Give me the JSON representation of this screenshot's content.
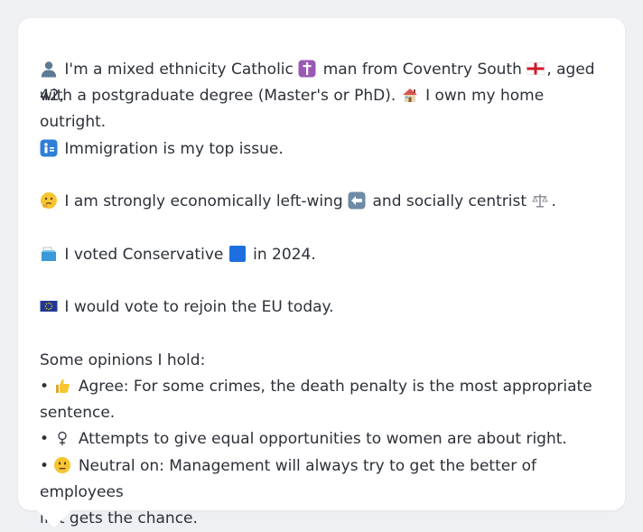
{
  "profile": {
    "intro_line1_part1": "I'm a mixed ethnicity Catholic",
    "intro_line1_part2": "man from Coventry South",
    "intro_line1_part3": ", aged 42,",
    "intro_line2_part1": "with a postgraduate degree (Master's or PhD).",
    "intro_line2_part2": "I own my home outright."
  },
  "top_issue": "Immigration is my top issue.",
  "stance": {
    "part1": "I am strongly economically left-wing",
    "part2": "and socially centrist",
    "part3": "."
  },
  "vote": {
    "part1": "I voted Conservative",
    "part2": "in 2024."
  },
  "eu": "I would vote to rejoin the EU today.",
  "opinions": {
    "heading": "Some opinions I hold:",
    "items": [
      {
        "bullet": "•",
        "line1": "Agree: For some crimes, the death penalty is the most appropriate",
        "line2": "sentence."
      },
      {
        "bullet": "•",
        "line1": "Attempts to give equal opportunities to women are about right."
      },
      {
        "bullet": "•",
        "line1": "Neutral on: Management will always try to get the better of employees",
        "line2": "if it gets the chance."
      }
    ]
  },
  "icons": {
    "person": "person-icon",
    "cross": "latin-cross-icon",
    "england_flag": "england-flag-icon",
    "house": "house-icon",
    "passport_control": "passport-control-icon",
    "thinking": "thinking-face-icon",
    "left_arrow": "left-arrow-icon",
    "scales": "balance-scale-icon",
    "ballot": "ballot-box-icon",
    "blue_square": "blue-square-icon",
    "eu_flag": "eu-flag-icon",
    "thumbs_up": "thumbs-up-icon",
    "female_sign": "female-sign-icon",
    "neutral_face": "neutral-face-icon"
  },
  "colors": {
    "background": "#eef0f3",
    "card": "#ffffff",
    "text": "#2c3138",
    "conservative_blue": "#1d6fe0"
  }
}
